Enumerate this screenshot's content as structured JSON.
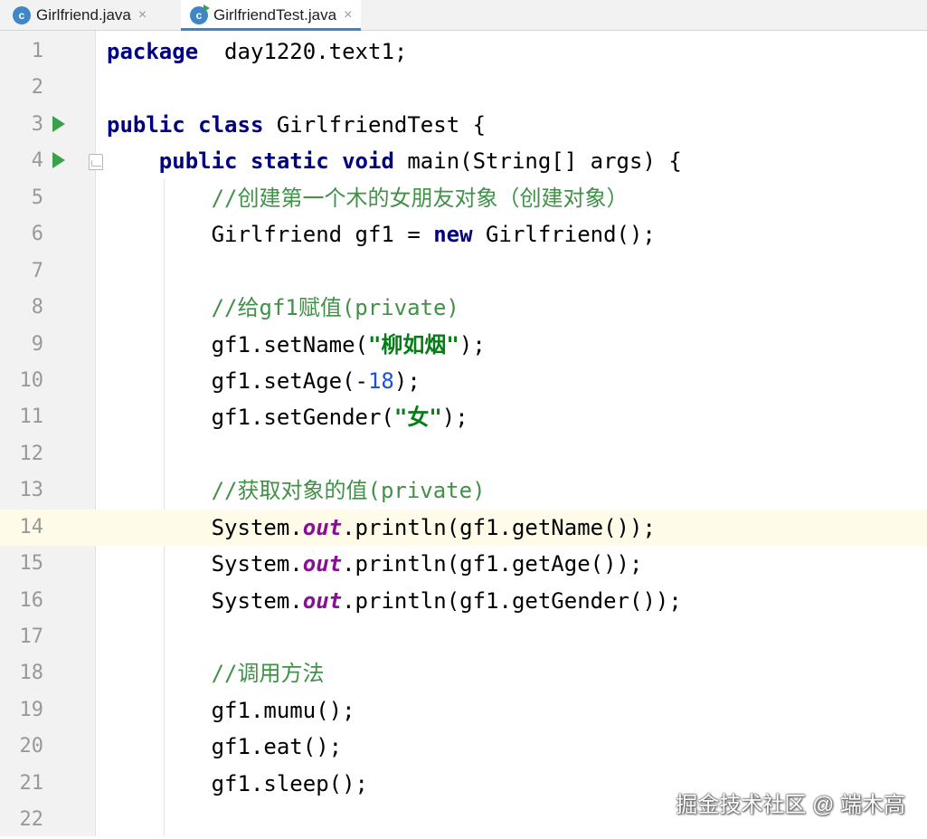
{
  "tabs": [
    {
      "label": "Girlfriend.java",
      "icon": "java-class-icon",
      "active": false
    },
    {
      "label": "GirlfriendTest.java",
      "icon": "java-runnable-class-icon",
      "active": true
    }
  ],
  "tab_close_glyph": "×",
  "current_line": 14,
  "lines": [
    {
      "n": "1",
      "tokens": [
        [
          "kw",
          "package"
        ],
        [
          "",
          "  day1220.text1;"
        ]
      ]
    },
    {
      "n": "2",
      "tokens": []
    },
    {
      "n": "3",
      "run": true,
      "tokens": [
        [
          "kw",
          "public"
        ],
        [
          "",
          " "
        ],
        [
          "kw",
          "class"
        ],
        [
          "",
          " GirlfriendTest {"
        ]
      ]
    },
    {
      "n": "4",
      "run": true,
      "fold": true,
      "tokens": [
        [
          "",
          "    "
        ],
        [
          "kw",
          "public"
        ],
        [
          "",
          " "
        ],
        [
          "kw",
          "static"
        ],
        [
          "",
          " "
        ],
        [
          "kw",
          "void"
        ],
        [
          "",
          " main(String[] args) {"
        ]
      ]
    },
    {
      "n": "5",
      "tokens": [
        [
          "",
          "        "
        ],
        [
          "cm",
          "//创建第一个木的女朋友对象（创建对象）"
        ]
      ]
    },
    {
      "n": "6",
      "tokens": [
        [
          "",
          "        Girlfriend gf1 = "
        ],
        [
          "kw",
          "new"
        ],
        [
          "",
          " Girlfriend();"
        ]
      ]
    },
    {
      "n": "7",
      "tokens": []
    },
    {
      "n": "8",
      "tokens": [
        [
          "",
          "        "
        ],
        [
          "cm",
          "//给gf1赋值(private)"
        ]
      ]
    },
    {
      "n": "9",
      "tokens": [
        [
          "",
          "        gf1.setName("
        ],
        [
          "st",
          "\"柳如烟\""
        ],
        [
          "",
          ");"
        ]
      ]
    },
    {
      "n": "10",
      "tokens": [
        [
          "",
          "        gf1.setAge(-"
        ],
        [
          "nm",
          "18"
        ],
        [
          "",
          ");"
        ]
      ]
    },
    {
      "n": "11",
      "tokens": [
        [
          "",
          "        gf1.setGender("
        ],
        [
          "st",
          "\"女\""
        ],
        [
          "",
          ");"
        ]
      ]
    },
    {
      "n": "12",
      "tokens": []
    },
    {
      "n": "13",
      "tokens": [
        [
          "",
          "        "
        ],
        [
          "cm",
          "//获取对象的值(private)"
        ]
      ]
    },
    {
      "n": "14",
      "tokens": [
        [
          "",
          "        System."
        ],
        [
          "fld",
          "out"
        ],
        [
          "",
          ".println(gf1.getName());"
        ]
      ]
    },
    {
      "n": "15",
      "tokens": [
        [
          "",
          "        System."
        ],
        [
          "fld",
          "out"
        ],
        [
          "",
          ".println(gf1.getAge());"
        ]
      ]
    },
    {
      "n": "16",
      "tokens": [
        [
          "",
          "        System."
        ],
        [
          "fld",
          "out"
        ],
        [
          "",
          ".println(gf1.getGender());"
        ]
      ]
    },
    {
      "n": "17",
      "tokens": []
    },
    {
      "n": "18",
      "tokens": [
        [
          "",
          "        "
        ],
        [
          "cm",
          "//调用方法"
        ]
      ]
    },
    {
      "n": "19",
      "tokens": [
        [
          "",
          "        gf1.mumu();"
        ]
      ]
    },
    {
      "n": "20",
      "tokens": [
        [
          "",
          "        gf1.eat();"
        ]
      ]
    },
    {
      "n": "21",
      "tokens": [
        [
          "",
          "        gf1.sleep();"
        ]
      ]
    },
    {
      "n": "22",
      "tokens": []
    }
  ],
  "watermark": "掘金技术社区 @ 端木高",
  "colors": {
    "keyword": "#000080",
    "comment": "#429148",
    "string": "#067d17",
    "number": "#1750eb",
    "static_field": "#871094",
    "current_line_bg": "#fffbe8",
    "tab_underline": "#4083c9"
  }
}
